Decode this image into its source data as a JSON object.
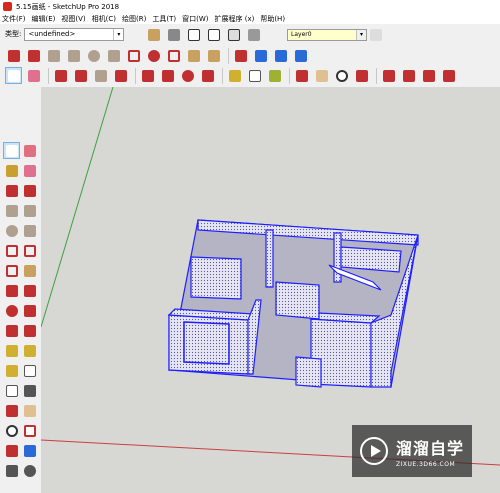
{
  "window": {
    "title": "5.15画纸 - SketchUp Pro 2018"
  },
  "menu": [
    "文件(F)",
    "编辑(E)",
    "视图(V)",
    "相机(C)",
    "绘图(R)",
    "工具(T)",
    "窗口(W)",
    "扩展程序 (x)",
    "帮助(H)"
  ],
  "style_bar": {
    "label": "类型:",
    "value": "<undefined>"
  },
  "layer_bar": {
    "value": "Layer0"
  },
  "toolbar_row1": [
    "line-icon",
    "freehand-icon",
    "rectangle-icon",
    "rotated-rectangle-icon",
    "circle-icon",
    "polygon-icon",
    "arc-icon",
    "pie-icon",
    "3pt-arc-icon",
    "arc2-icon",
    "component-icon",
    "warehouse-icon",
    "home-icon",
    "house-icon",
    "box-icon",
    "extension-icon",
    "select-icon"
  ],
  "toolbar_row2": [
    "select-icon",
    "eraser-icon",
    "pencil-icon",
    "arc-tool-icon",
    "rectangle-tool-icon",
    "push-pull-icon",
    "follow-me-icon",
    "move-icon",
    "rotate-icon",
    "scale-icon",
    "offset-icon",
    "tape-measure-icon",
    "text-icon",
    "paint-bucket-icon",
    "orbit-icon",
    "pan-icon",
    "zoom-icon",
    "zoom-extents-icon",
    "warehouse-get-icon",
    "warehouse-share-icon",
    "ext-warehouse-icon",
    "ruby-icon"
  ],
  "left_tools": [
    "select-icon",
    "component-icon",
    "paint-icon",
    "eraser-icon",
    "line-icon",
    "freehand-icon",
    "rectangle-icon",
    "rotated-rect-icon",
    "circle-icon",
    "polygon-icon",
    "arc-icon",
    "arc-2pt-icon",
    "arc-3pt-icon",
    "pie-icon",
    "move-icon",
    "push-pull-icon",
    "rotate-icon",
    "follow-me-icon",
    "scale-icon",
    "offset-icon",
    "tape-measure-icon",
    "dimension-icon",
    "protractor-icon",
    "text-icon",
    "axes-icon",
    "3d-text-icon",
    "orbit-icon",
    "pan-icon",
    "zoom-icon",
    "zoom-window-icon",
    "zoom-extents-icon",
    "position-camera-icon",
    "walk-icon",
    "look-around-icon"
  ],
  "colors": {
    "model_outline": "#1f1fff",
    "face": "#dfdff0",
    "hidden_face": "#f0f0f6",
    "x_axis": "#c84040",
    "y_axis": "#40a040",
    "sky": "#d7d7d4"
  },
  "watermark": {
    "title": "溜溜自学",
    "subtitle": "ZIXUE.3D66.COM"
  }
}
